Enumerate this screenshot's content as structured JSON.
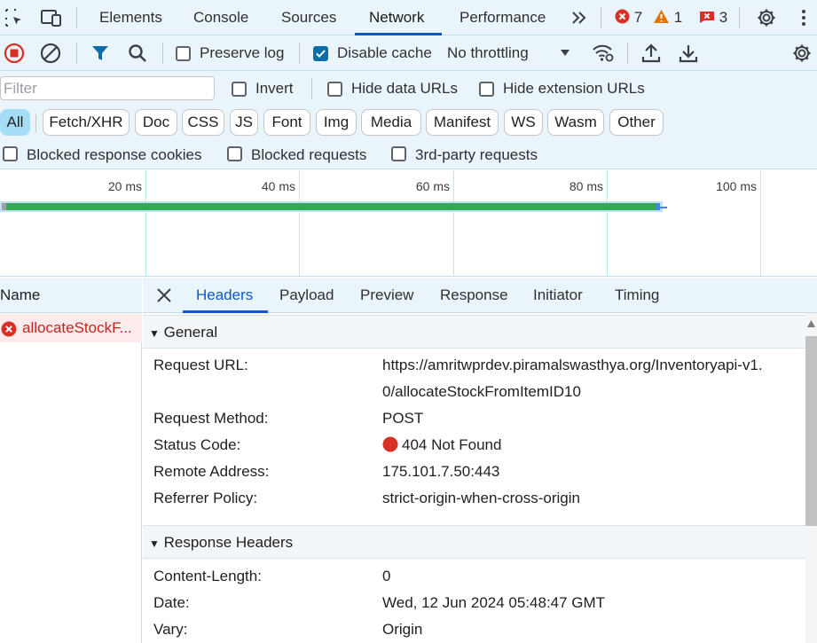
{
  "tabs": {
    "elements": "Elements",
    "console": "Console",
    "sources": "Sources",
    "network": "Network",
    "performance": "Performance"
  },
  "badges": {
    "errors": "7",
    "warnings": "1",
    "issues": "3"
  },
  "toolbar": {
    "preserve_log": "Preserve log",
    "disable_cache": "Disable cache",
    "throttling": "No throttling"
  },
  "filter": {
    "placeholder": "Filter",
    "invert": "Invert",
    "hide_data_urls": "Hide data URLs",
    "hide_extension_urls": "Hide extension URLs"
  },
  "chips": [
    "All",
    "Fetch/XHR",
    "Doc",
    "CSS",
    "JS",
    "Font",
    "Img",
    "Media",
    "Manifest",
    "WS",
    "Wasm",
    "Other"
  ],
  "blocked": {
    "cookies": "Blocked response cookies",
    "requests": "Blocked requests",
    "third_party": "3rd-party requests"
  },
  "overview": {
    "ticks": [
      "20 ms",
      "40 ms",
      "60 ms",
      "80 ms",
      "100 ms"
    ]
  },
  "request_list": {
    "header": "Name",
    "rows": [
      {
        "name": "allocateStockF..."
      }
    ]
  },
  "detail_tabs": {
    "headers": "Headers",
    "payload": "Payload",
    "preview": "Preview",
    "response": "Response",
    "initiator": "Initiator",
    "timing": "Timing"
  },
  "general": {
    "title": "General",
    "request_url_key": "Request URL:",
    "request_url_line1": "https://amritwprdev.piramalswasthya.org/Inventoryapi-v1.",
    "request_url_line2": "0/allocateStockFromItemID10",
    "request_method_key": "Request Method:",
    "request_method": "POST",
    "status_code_key": "Status Code:",
    "status_code": "404 Not Found",
    "remote_address_key": "Remote Address:",
    "remote_address": "175.101.7.50:443",
    "referrer_policy_key": "Referrer Policy:",
    "referrer_policy": "strict-origin-when-cross-origin"
  },
  "response_headers": {
    "title": "Response Headers",
    "content_length_key": "Content-Length:",
    "content_length": "0",
    "date_key": "Date:",
    "date": "Wed, 12 Jun 2024 05:48:47 GMT",
    "vary_key": "Vary:",
    "vary": "Origin"
  },
  "colors": {
    "accent": "#0b57d0",
    "error": "#d93025",
    "warning": "#e37400",
    "bar": "#34a853"
  }
}
